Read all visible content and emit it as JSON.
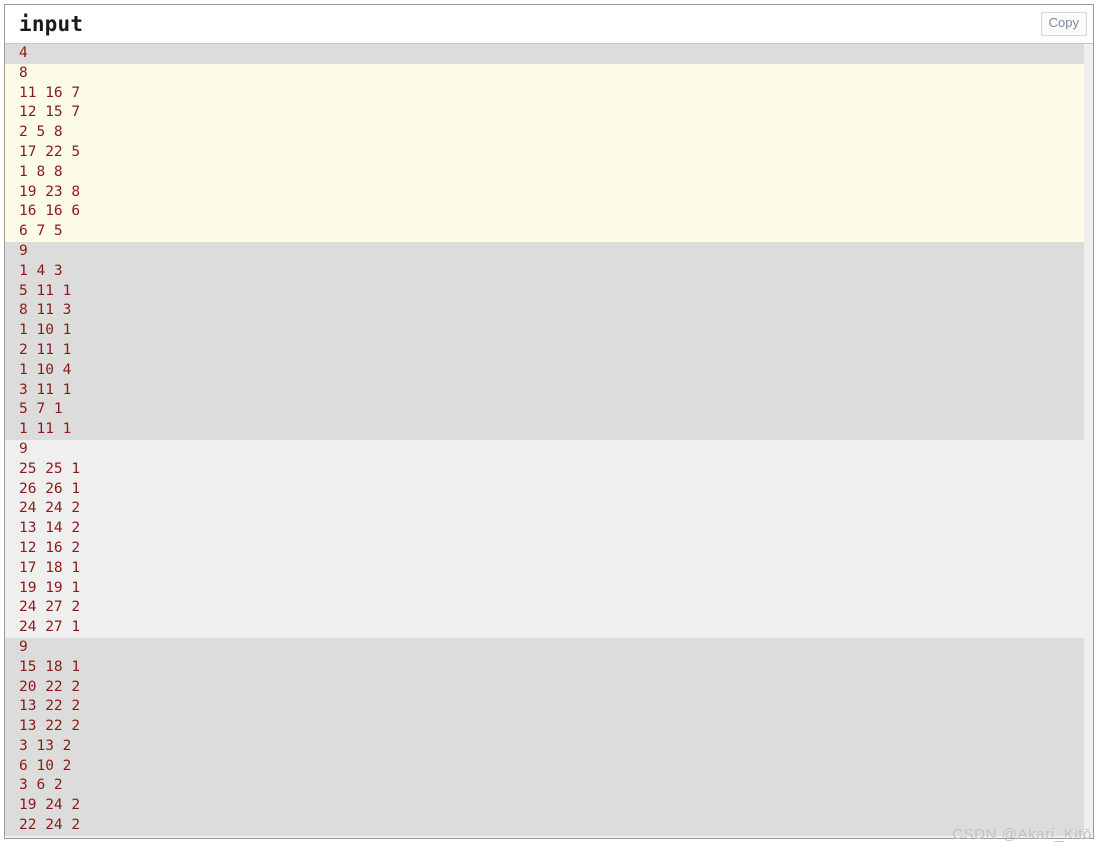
{
  "panel": {
    "title": "input",
    "copy_label": "Copy"
  },
  "colors": {
    "text": "#8b1a1a",
    "block_gray": "#dcdcdc",
    "block_cream": "#fdfce8",
    "block_light": "#efefef",
    "border": "#999999",
    "title_text": "#1a1a1a",
    "copy_text": "#7a8899",
    "watermark": "#c2c2c2"
  },
  "blocks": [
    {
      "background": "#dcdcdc",
      "lines": [
        "4"
      ]
    },
    {
      "background": "#fdfce8",
      "lines": [
        "8",
        "11 16 7",
        "12 15 7",
        "2 5 8",
        "17 22 5",
        "1 8 8",
        "19 23 8",
        "16 16 6",
        "6 7 5"
      ]
    },
    {
      "background": "#dcdcdc",
      "lines": [
        "9",
        "1 4 3",
        "5 11 1",
        "8 11 3",
        "1 10 1",
        "2 11 1",
        "1 10 4",
        "3 11 1",
        "5 7 1",
        "1 11 1"
      ]
    },
    {
      "background": "#efefef",
      "lines": [
        "9",
        "25 25 1",
        "26 26 1",
        "24 24 2",
        "13 14 2",
        "12 16 2",
        "17 18 1",
        "19 19 1",
        "24 27 2",
        "24 27 1"
      ]
    },
    {
      "background": "#dcdcdc",
      "lines": [
        "9",
        "15 18 1",
        "20 22 2",
        "13 22 2",
        "13 22 2",
        "3 13 2",
        "6 10 2",
        "3 6 2",
        "19 24 2",
        "22 24 2"
      ]
    }
  ],
  "watermark": {
    "text": "CSDN @Akari_Kitō"
  }
}
